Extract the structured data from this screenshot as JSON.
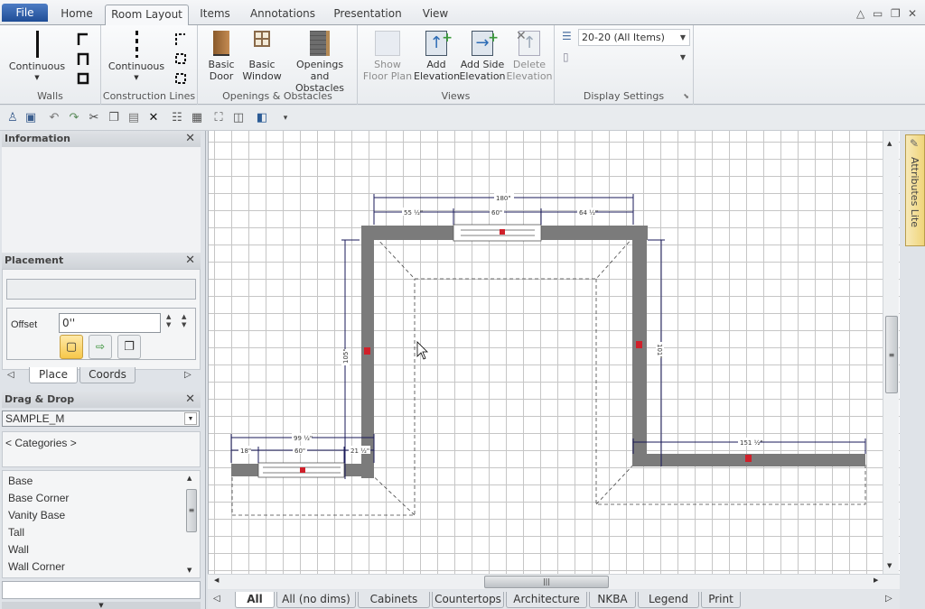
{
  "ribbon_tabs": [
    {
      "label": "File"
    },
    {
      "label": "Home"
    },
    {
      "label": "Room Layout",
      "active": true
    },
    {
      "label": "Items"
    },
    {
      "label": "Annotations"
    },
    {
      "label": "Presentation"
    },
    {
      "label": "View"
    }
  ],
  "window_controls": {
    "help": "△",
    "minimize": "▭",
    "restore": "❐",
    "close": "✕"
  },
  "ribbon": {
    "walls": {
      "label": "Walls",
      "continuous": "Continuous"
    },
    "construction": {
      "label": "Construction Lines",
      "continuous": "Continuous"
    },
    "openings": {
      "label": "Openings & Obstacles",
      "basic_door": [
        "Basic",
        "Door"
      ],
      "basic_window": [
        "Basic",
        "Window"
      ],
      "openings_obstacles": [
        "Openings",
        "and Obstacles"
      ]
    },
    "views": {
      "label": "Views",
      "show_floor_plan": [
        "Show",
        "Floor Plan"
      ],
      "add_elevation": [
        "Add",
        "Elevation"
      ],
      "add_side_elevation": [
        "Add Side",
        "Elevation"
      ],
      "delete_elevation": [
        "Delete",
        "Elevation"
      ]
    },
    "display": {
      "label": "Display Settings",
      "catalog_value": "20-20 (All Items)",
      "second_value": ""
    }
  },
  "panels": {
    "information": {
      "title": "Information",
      "close": "✕"
    },
    "placement": {
      "title": "Placement",
      "close": "✕",
      "offset_label": "Offset",
      "offset_value": "0''",
      "tabs": [
        "Place",
        "Coords"
      ]
    },
    "dragdrop": {
      "title": "Drag & Drop",
      "close": "✕",
      "catalog": "SAMPLE_M",
      "categories": "< Categories >",
      "items": [
        "Base",
        "Base Corner",
        "Vanity Base",
        "Tall",
        "Wall",
        "Wall Corner"
      ]
    }
  },
  "attributes_tab": "Attributes Lite",
  "bottom_tabs": [
    {
      "label": "All",
      "active": true
    },
    {
      "label": "All (no dims)"
    },
    {
      "label": "Cabinets"
    },
    {
      "label": "Countertops"
    },
    {
      "label": "Architecture"
    },
    {
      "label": "NKBA"
    },
    {
      "label": "Legend"
    },
    {
      "label": "Print"
    }
  ],
  "dimensions": {
    "top_total": "180\"",
    "top_left": "55 ½\"",
    "top_window": "60\"",
    "top_right": "64 ½\"",
    "left_wall": "105\"",
    "right_wall": "101\"",
    "bottom_left_total": "99 ½\"",
    "bottom_left_a": "18\"",
    "bottom_left_window": "60\"",
    "bottom_left_b": "21 ½\"",
    "bottom_right_total": "151 ½\""
  },
  "colors": {
    "accent": "#1f4d96",
    "wall": "#7a7a7a",
    "handle": "#d0202a",
    "dim": "#1a1a5a"
  }
}
